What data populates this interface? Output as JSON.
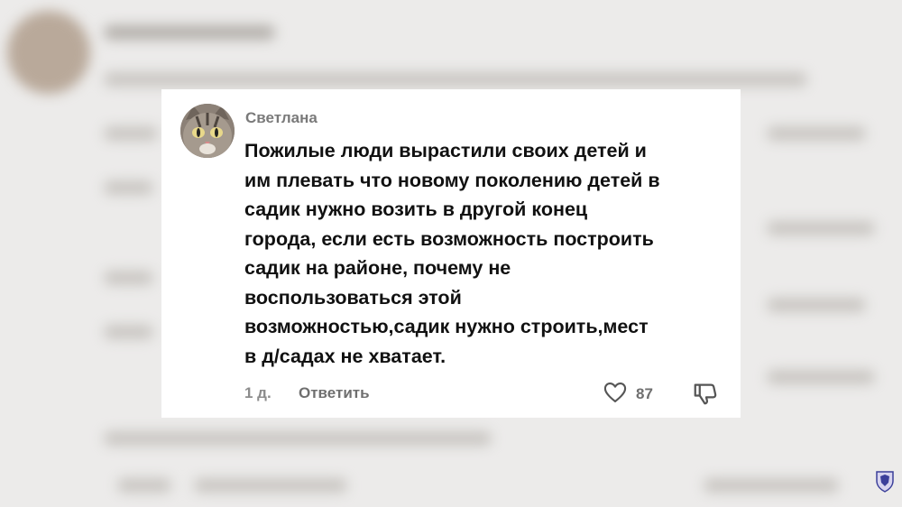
{
  "comment": {
    "author": "Светлана",
    "body_lines": [
      "Пожилые люди вырастили своих детей и",
      "им плевать что новому поколению детей в",
      "садик нужно возить в другой конец",
      "города, если есть возможность построить",
      "садик на районе, почему не",
      "воспользоваться этой",
      "возможностью,садик нужно строить,мест",
      "в д/садах не хватает."
    ],
    "timestamp": "1 д.",
    "reply_label": "Ответить",
    "like_count": "87",
    "avatar_icon": "cat-avatar",
    "like_icon": "heart-icon",
    "dislike_icon": "thumbs-down-icon"
  },
  "colors": {
    "background": "#ecebea",
    "card": "#ffffff",
    "text": "#111111",
    "muted": "#7a7a7a"
  }
}
